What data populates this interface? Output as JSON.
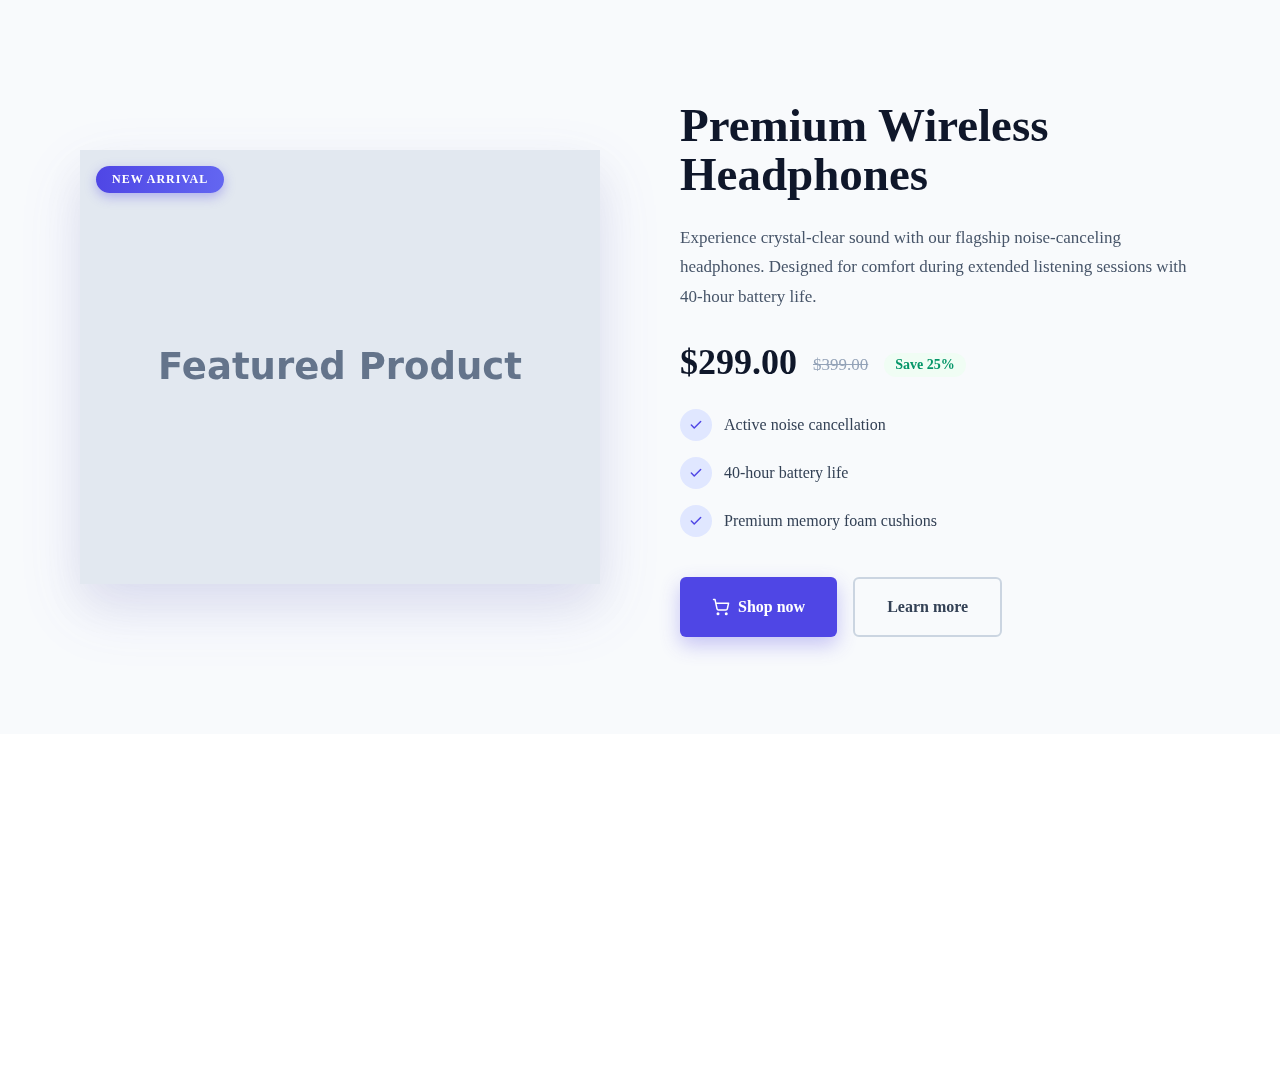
{
  "image": {
    "badge": "NEW ARRIVAL",
    "placeholder_text": "Featured Product"
  },
  "title": "Premium Wireless Headphones",
  "description": "Experience crystal-clear sound with our flagship noise-canceling headphones. Designed for comfort during extended listening sessions with 40-hour battery life.",
  "price": {
    "current": "$299.00",
    "original": "$399.00",
    "savings": "Save 25%"
  },
  "features": [
    "Active noise cancellation",
    "40-hour battery life",
    "Premium memory foam cushions"
  ],
  "buttons": [
    {
      "kind": "primary",
      "label": "Shop now"
    },
    {
      "kind": "secondary",
      "label": "Learn more"
    }
  ]
}
